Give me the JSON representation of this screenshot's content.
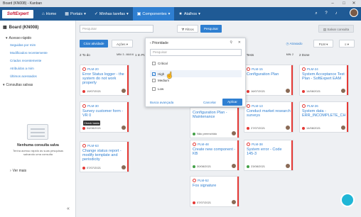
{
  "window": {
    "title": "Board (KN008) - Kanban"
  },
  "nav": {
    "logo": "SoftExpert",
    "items": [
      {
        "label": "Home",
        "icon": "⌂"
      },
      {
        "label": "Portais",
        "icon": "▦"
      },
      {
        "label": "Minhas tarefas",
        "icon": "✓"
      },
      {
        "label": "Componentes",
        "icon": "▣"
      },
      {
        "label": "Atalhos",
        "icon": "★"
      }
    ]
  },
  "sidebar": {
    "title": "Board (KN008)",
    "quick_title": "Acesso rápido",
    "quick": [
      "Seguidas por mim",
      "Modificados recentemente",
      "Criados recentemente",
      "Atribuídos a mim",
      "Últimos acessados"
    ],
    "saved_title": "Consultas salvas",
    "empty_title": "Nenhuma consulta salva",
    "empty_desc": "Tenha acesso rápido às suas pesquisas salvando uma consulta",
    "see_more": "Ver mais"
  },
  "toolbar": {
    "search_placeholder": "Pesquisar",
    "filters": "Filtros",
    "search": "Pesquisar",
    "save_query": "Salvar consulta",
    "create": "Criar atividade",
    "actions": "Ações",
    "delayed": "Atrasado",
    "plm": "PLM"
  },
  "columns": [
    {
      "num": "2",
      "name": "To do",
      "limit": "MIN: 3 - MAX:6"
    },
    {
      "num": "1",
      "name": "In Pr...",
      "limit": ""
    },
    {
      "num": "",
      "name": "",
      "limit": ""
    },
    {
      "num": "3",
      "name": "Tests",
      "limit": "MIN: 2"
    },
    {
      "num": "2",
      "name": "Done",
      "limit": ""
    }
  ],
  "cards": [
    {
      "id": "PLM-20",
      "title": "Error Status logger - the system do not work properly",
      "date": "19/07/2021",
      "status": "#e53935"
    },
    {
      "id": "PLM-30",
      "title": "Survey customer form - VR 0",
      "date": "04/08/2021",
      "status": "#e53935"
    },
    {
      "id": "PLM-63",
      "title": "Change status report - modify template and periodicity",
      "date": "07/07/2021",
      "status": "#e53935"
    },
    {
      "id": "",
      "title": "Configuration Plan - Maintenance",
      "date": "Não preenchido",
      "status": "#43a047"
    },
    {
      "id": "PLM-48",
      "title": "Create new component - KB",
      "date": "30/08/2021",
      "status": "#43a047"
    },
    {
      "id": "PLM-52",
      "title": "Fos signature",
      "date": "07/07/2021",
      "status": "#e53935"
    },
    {
      "id": "PLM-15",
      "title": "Configuration Plan",
      "date": "16/07/2021",
      "status": "#e53935"
    },
    {
      "id": "PLM-13",
      "title": "Conduct market research surveys",
      "date": "27/07/2021",
      "status": "#e53935"
    },
    {
      "id": "PLM-38",
      "title": "System error - Code 145-3",
      "date": "23/08/2021",
      "status": "#43a047"
    },
    {
      "id": "PLM-24",
      "title": "System Acceptance Test Plan - SoftExpert EAM",
      "date": "14/08/2021",
      "status": "#e53935"
    },
    {
      "id": "PLM-26",
      "title": "System data - ERR_INCOMPLETE_CH",
      "date": "14/08/2021",
      "status": "#e53935"
    }
  ],
  "tooltip": "Check tasks",
  "popup": {
    "title": "Prioridade",
    "search_placeholder": "Pesquisar",
    "options": [
      {
        "label": "Critical",
        "checked": false
      },
      {
        "label": "High",
        "checked": true
      },
      {
        "label": "Medium",
        "checked": false
      },
      {
        "label": "Low",
        "checked": false
      }
    ],
    "advanced": "Busca avançada",
    "cancel": "Cancelar",
    "apply": "Aplicar"
  }
}
